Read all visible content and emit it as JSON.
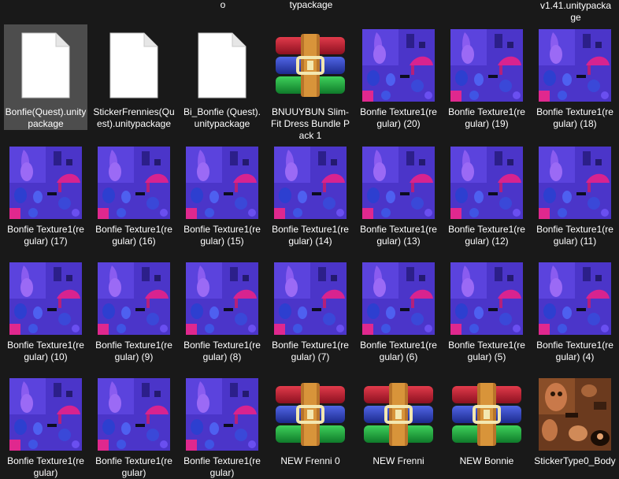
{
  "view": "file-explorer-large-icons",
  "top_fragments": [
    {
      "text": "o"
    },
    {
      "text": "typackage"
    },
    {
      "text": "v1.41.unitypacka ge"
    }
  ],
  "files": [
    {
      "label": "Bonfie(Quest).unitypackage",
      "icon": "document-icon",
      "selected": true
    },
    {
      "label": "StickerFrennies(Quest).unitypackage",
      "icon": "document-icon"
    },
    {
      "label": "Bi_Bonfie (Quest).unitypackage",
      "icon": "document-icon"
    },
    {
      "label": "BNUUYBUN Slim-Fit Dress Bundle Pack 1",
      "icon": "archive-icon"
    },
    {
      "label": "Bonfie Texture1(regular) (20)",
      "icon": "texture-thumbnail"
    },
    {
      "label": "Bonfie Texture1(regular) (19)",
      "icon": "texture-thumbnail"
    },
    {
      "label": "Bonfie Texture1(regular) (18)",
      "icon": "texture-thumbnail"
    },
    {
      "label": "Bonfie Texture1(regular) (17)",
      "icon": "texture-thumbnail"
    },
    {
      "label": "Bonfie Texture1(regular) (16)",
      "icon": "texture-thumbnail"
    },
    {
      "label": "Bonfie Texture1(regular) (15)",
      "icon": "texture-thumbnail"
    },
    {
      "label": "Bonfie Texture1(regular) (14)",
      "icon": "texture-thumbnail"
    },
    {
      "label": "Bonfie Texture1(regular) (13)",
      "icon": "texture-thumbnail"
    },
    {
      "label": "Bonfie Texture1(regular) (12)",
      "icon": "texture-thumbnail"
    },
    {
      "label": "Bonfie Texture1(regular) (11)",
      "icon": "texture-thumbnail"
    },
    {
      "label": "Bonfie Texture1(regular) (10)",
      "icon": "texture-thumbnail"
    },
    {
      "label": "Bonfie Texture1(regular) (9)",
      "icon": "texture-thumbnail"
    },
    {
      "label": "Bonfie Texture1(regular) (8)",
      "icon": "texture-thumbnail"
    },
    {
      "label": "Bonfie Texture1(regular) (7)",
      "icon": "texture-thumbnail"
    },
    {
      "label": "Bonfie Texture1(regular) (6)",
      "icon": "texture-thumbnail"
    },
    {
      "label": "Bonfie Texture1(regular) (5)",
      "icon": "texture-thumbnail"
    },
    {
      "label": "Bonfie Texture1(regular) (4)",
      "icon": "texture-thumbnail"
    },
    {
      "label": "Bonfie Texture1(regular)",
      "icon": "texture-thumbnail"
    },
    {
      "label": "Bonfie Texture1(regular)",
      "icon": "texture-thumbnail"
    },
    {
      "label": "Bonfie Texture1(regular)",
      "icon": "texture-thumbnail"
    },
    {
      "label": "NEW Frenni 0",
      "icon": "archive-icon"
    },
    {
      "label": "NEW Frenni",
      "icon": "archive-icon"
    },
    {
      "label": "NEW Bonnie",
      "icon": "archive-icon"
    },
    {
      "label": "StickerType0_Body",
      "icon": "sticker-thumbnail"
    }
  ],
  "colors": {
    "background": "#191919",
    "selection": "#4d4d4d",
    "texture_base": "#5a3fd8",
    "texture_accent": "#e0288e",
    "sticker_base": "#b5673a"
  }
}
